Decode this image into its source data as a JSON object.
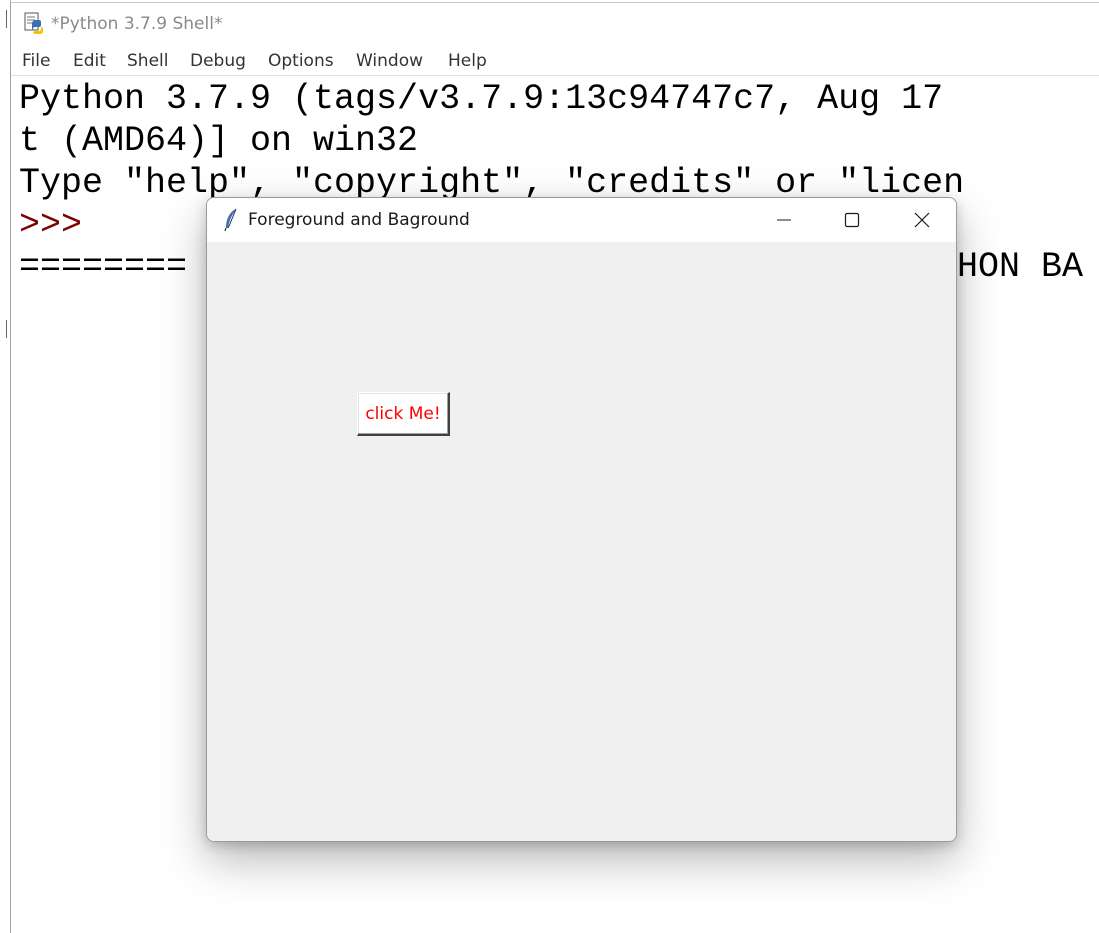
{
  "shell": {
    "title": "*Python 3.7.9 Shell*",
    "menu": [
      "File",
      "Edit",
      "Shell",
      "Debug",
      "Options",
      "Window",
      "Help"
    ],
    "lines": [
      "Python 3.7.9 (tags/v3.7.9:13c94747c7, Aug 17",
      "t (AMD64)] on win32",
      "Type \"help\", \"copyright\", \"credits\" or \"licen",
      ">>> ",
      "========"
    ],
    "restart_tail": "HON BA"
  },
  "tk_window": {
    "title": "Foreground and Baground",
    "controls": {
      "minimize": "minimize-icon",
      "maximize": "maximize-icon",
      "close": "close-icon"
    },
    "button": {
      "label": "click Me!",
      "fg_color": "#ff0000",
      "bg_color": "#ffffff"
    }
  },
  "colors": {
    "prompt": "#800000",
    "window_bg": "#f0f0f0"
  }
}
